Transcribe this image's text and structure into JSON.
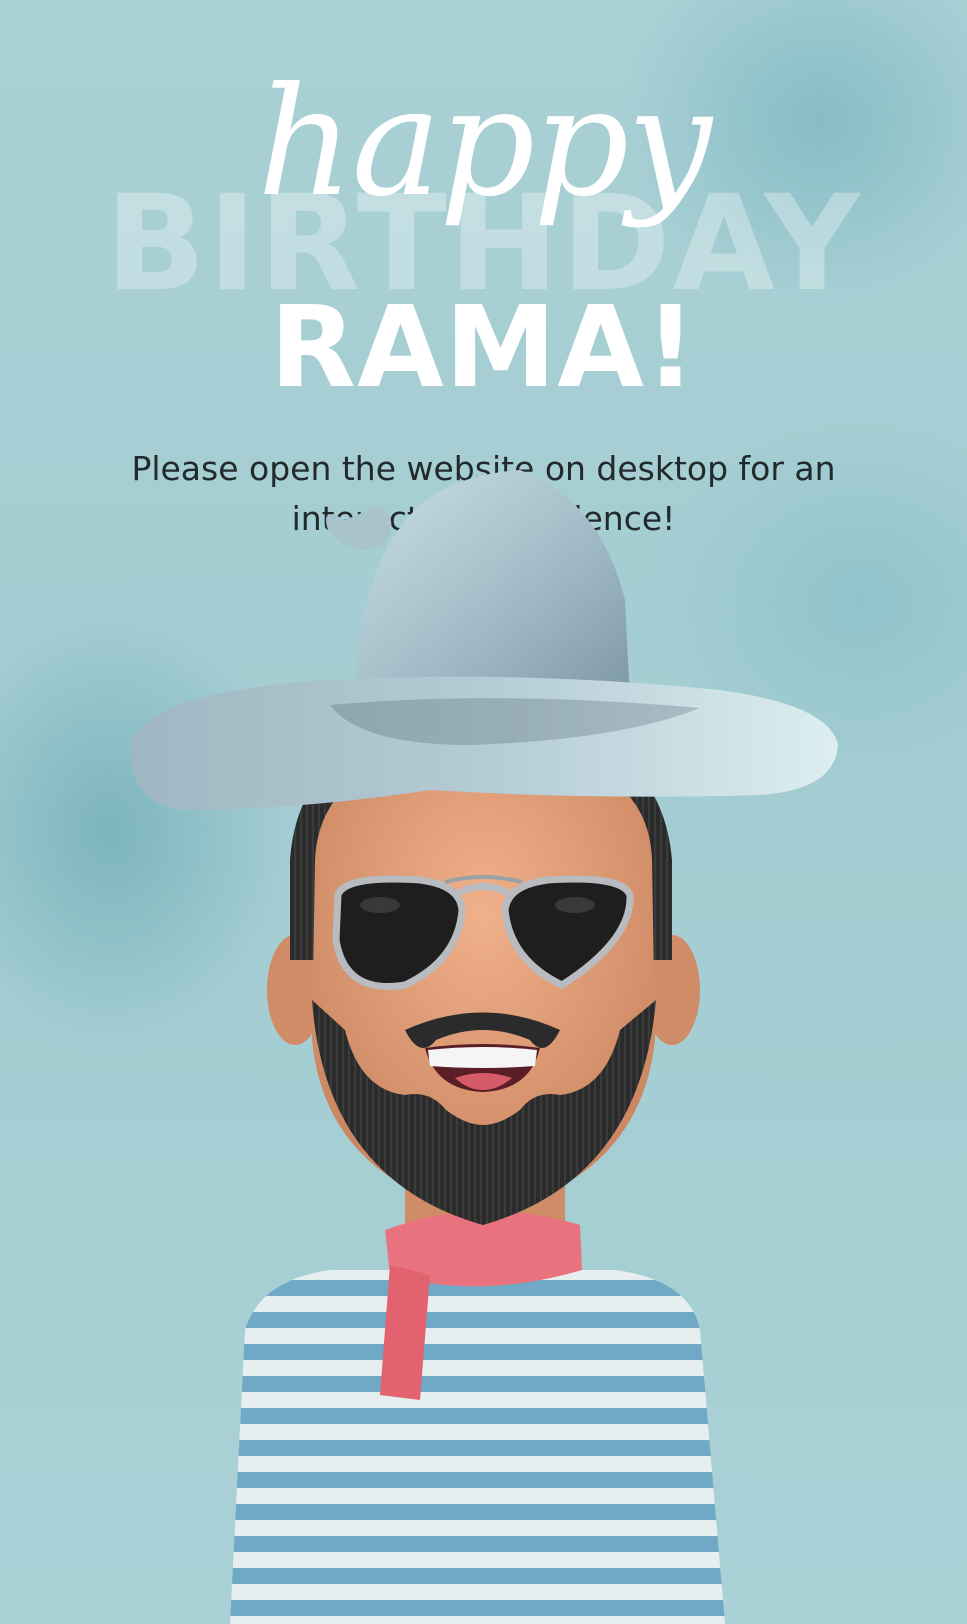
{
  "greeting": {
    "script_word": "happy",
    "outline_word": "BIRTHDAY",
    "name": "RAMA!"
  },
  "message": "Please open the website on desktop for an interactive experience!",
  "colors": {
    "background": "#a7cfd4",
    "hat": "#a9c5d0",
    "skin": "#d99a72",
    "beard": "#2b2b2b",
    "scarf": "#e8737e",
    "shirt_stripe": "#6fa9c6"
  },
  "avatar": {
    "icon": "bearded-man-avatar-icon"
  }
}
